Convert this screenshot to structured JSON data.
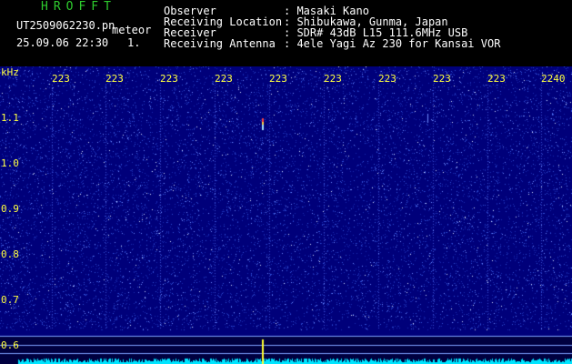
{
  "header": {
    "logo": "HROFFT",
    "filename": "UT2509062230.pn",
    "mode": "meteor",
    "datetime": "25.09.06 22:30",
    "count": "1.",
    "info_labels": [
      "Observer",
      "Receiving Location",
      "Receiver",
      "Receiving Antenna"
    ],
    "info_values": [
      ": Masaki Kano",
      ": Shibukawa, Gunma, Japan",
      ": SDR# 43dB L15 111.6MHz USB",
      ": 4ele Yagi Az 230 for Kansai VOR"
    ]
  },
  "axis": {
    "unit": "kHz",
    "y_ticks": [
      "1.1",
      "1.0",
      "0.9",
      "0.8",
      "0.7",
      "0.6"
    ],
    "x_ticks": [
      "223",
      "223",
      "223",
      "223",
      "223",
      "223",
      "223",
      "223",
      "223",
      "2240"
    ]
  },
  "colors": {
    "background": "#00007a",
    "axis_text": "#ffff40",
    "trace": "#00e5ff",
    "logo": "#2ecc2e"
  }
}
